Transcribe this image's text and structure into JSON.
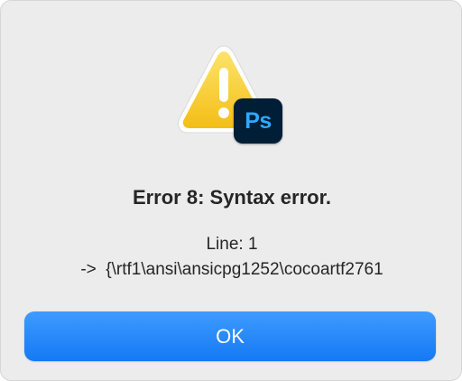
{
  "dialog": {
    "icon": {
      "primary": "warning-triangle-icon",
      "badge": "photoshop-app-icon",
      "badge_text": "Ps",
      "colors": {
        "warning_yellow": "#f7c928",
        "badge_background": "#001e36",
        "badge_text": "#31a8ff"
      }
    },
    "title": "Error 8: Syntax error.",
    "detail_line1": "Line: 1",
    "detail_line2": "->  {\\rtf1\\ansi\\ansicpg1252\\cocoartf2761",
    "ok_button": {
      "label": "OK",
      "color": "#1a7ff7"
    }
  }
}
